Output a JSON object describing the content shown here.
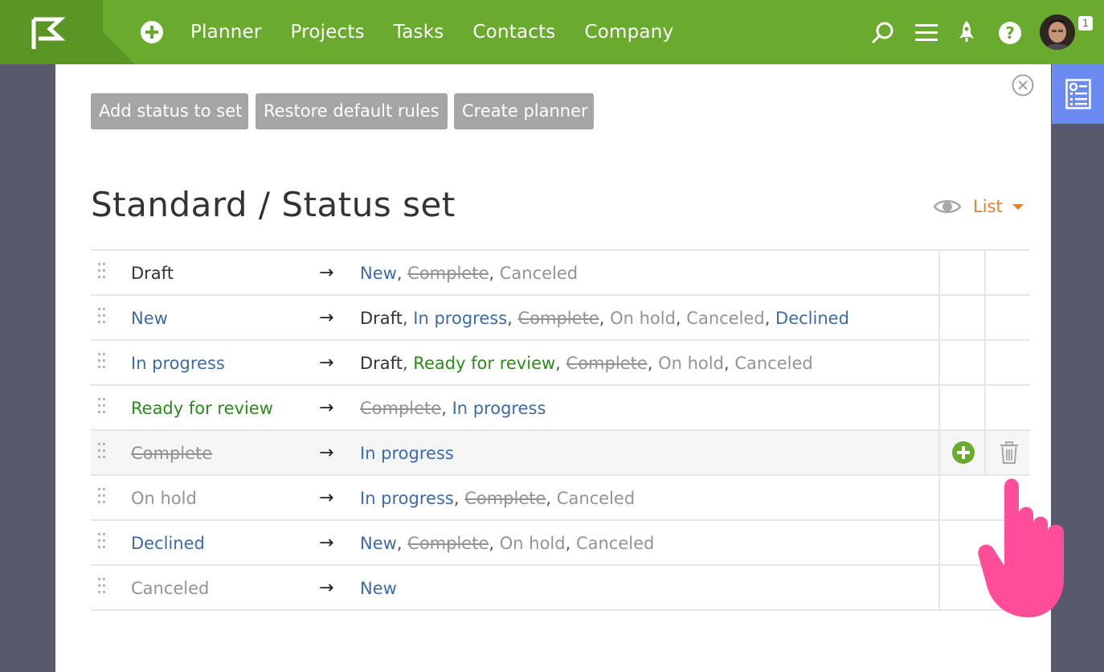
{
  "topbar": {
    "nav": [
      "Planner",
      "Projects",
      "Tasks",
      "Contacts",
      "Company"
    ],
    "badge": "1",
    "icons": [
      "flag-logo-icon",
      "add-circle-icon",
      "search-icon",
      "menu-icon",
      "rocket-icon",
      "help-icon",
      "avatar"
    ]
  },
  "toolbar": {
    "add_status": "Add status to set",
    "restore_rules": "Restore default rules",
    "create_planner": "Create planner"
  },
  "page": {
    "title": "Standard / Status set",
    "view_label": "List"
  },
  "colors": {
    "topbar": "#6aaa2e",
    "side_tab": "#6c8bf0",
    "accent_orange": "#f07d1e",
    "status_blue": "#3d6aa8",
    "status_green": "#2a8a1a",
    "status_gray": "#939393",
    "add_green": "#6aaa2e",
    "hand_pink": "#ff4d9a"
  },
  "arrow": "→",
  "rows": [
    {
      "status": {
        "text": "Draft",
        "kind": "dark"
      },
      "transitions": [
        {
          "text": "New",
          "kind": "blue"
        },
        {
          "text": "Complete",
          "kind": "strike"
        },
        {
          "text": "Canceled",
          "kind": "gray"
        }
      ]
    },
    {
      "status": {
        "text": "New",
        "kind": "blue"
      },
      "transitions": [
        {
          "text": "Draft",
          "kind": "dark"
        },
        {
          "text": "In progress",
          "kind": "blue"
        },
        {
          "text": "Complete",
          "kind": "strike"
        },
        {
          "text": "On hold",
          "kind": "gray"
        },
        {
          "text": "Canceled",
          "kind": "gray"
        },
        {
          "text": "Declined",
          "kind": "blue"
        }
      ]
    },
    {
      "status": {
        "text": "In progress",
        "kind": "blue"
      },
      "transitions": [
        {
          "text": "Draft",
          "kind": "dark"
        },
        {
          "text": "Ready for review",
          "kind": "green"
        },
        {
          "text": "Complete",
          "kind": "strike"
        },
        {
          "text": "On hold",
          "kind": "gray"
        },
        {
          "text": "Canceled",
          "kind": "gray"
        }
      ]
    },
    {
      "status": {
        "text": "Ready for review",
        "kind": "green"
      },
      "transitions": [
        {
          "text": "Complete",
          "kind": "strike"
        },
        {
          "text": "In progress",
          "kind": "blue"
        }
      ]
    },
    {
      "status": {
        "text": "Complete",
        "kind": "strike"
      },
      "highlighted": true,
      "transitions": [
        {
          "text": "In progress",
          "kind": "blue"
        }
      ]
    },
    {
      "status": {
        "text": "On hold",
        "kind": "gray"
      },
      "transitions": [
        {
          "text": "In progress",
          "kind": "blue"
        },
        {
          "text": "Complete",
          "kind": "strike"
        },
        {
          "text": "Canceled",
          "kind": "gray"
        }
      ]
    },
    {
      "status": {
        "text": "Declined",
        "kind": "blue"
      },
      "transitions": [
        {
          "text": "New",
          "kind": "blue"
        },
        {
          "text": "Complete",
          "kind": "strike"
        },
        {
          "text": "On hold",
          "kind": "gray"
        },
        {
          "text": "Canceled",
          "kind": "gray"
        }
      ]
    },
    {
      "status": {
        "text": "Canceled",
        "kind": "gray"
      },
      "transitions": [
        {
          "text": "New",
          "kind": "blue"
        }
      ]
    }
  ]
}
